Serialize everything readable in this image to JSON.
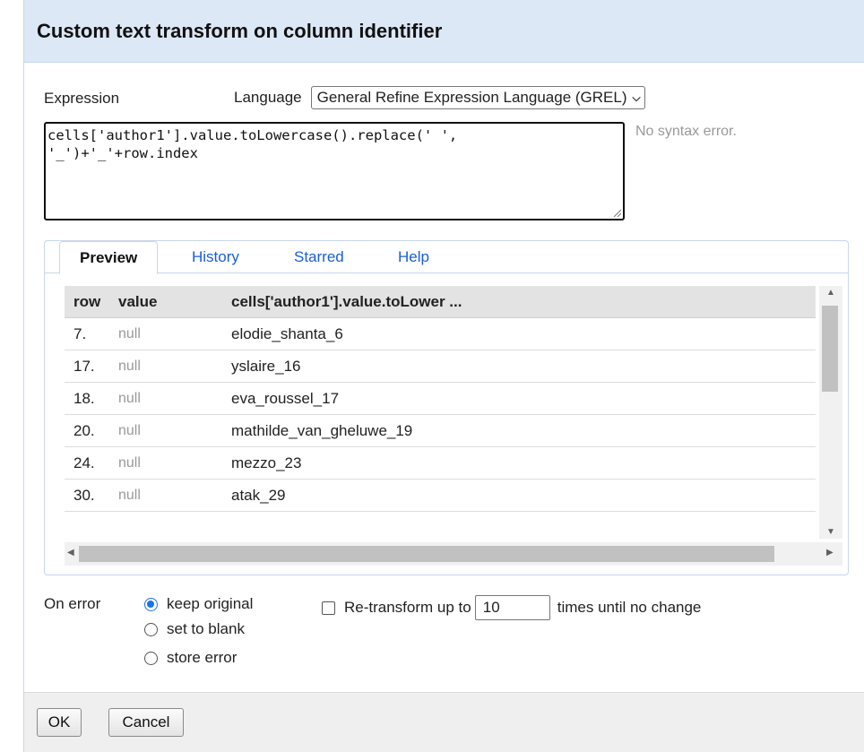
{
  "dialog": {
    "title": "Custom text transform on column identifier"
  },
  "expression": {
    "label": "Expression",
    "language_label": "Language",
    "language_selected": "General Refine Expression Language (GREL)",
    "code": "cells['author1'].value.toLowercase().replace(' ',\n'_')+'_'+row.index",
    "syntax_status": "No syntax error."
  },
  "tabs": [
    {
      "label": "Preview",
      "active": true
    },
    {
      "label": "History",
      "active": false
    },
    {
      "label": "Starred",
      "active": false
    },
    {
      "label": "Help",
      "active": false
    }
  ],
  "preview": {
    "headers": {
      "row": "row",
      "value": "value",
      "result": "cells['author1'].value.toLower ..."
    },
    "rows": [
      {
        "row": "7.",
        "value": "null",
        "result": "elodie_shanta_6"
      },
      {
        "row": "17.",
        "value": "null",
        "result": "yslaire_16"
      },
      {
        "row": "18.",
        "value": "null",
        "result": "eva_roussel_17"
      },
      {
        "row": "20.",
        "value": "null",
        "result": "mathilde_van_gheluwe_19"
      },
      {
        "row": "24.",
        "value": "null",
        "result": "mezzo_23"
      },
      {
        "row": "30.",
        "value": "null",
        "result": "atak_29"
      }
    ]
  },
  "on_error": {
    "label": "On error",
    "options": [
      {
        "label": "keep original",
        "selected": true
      },
      {
        "label": "set to blank",
        "selected": false
      },
      {
        "label": "store error",
        "selected": false
      }
    ]
  },
  "retransform": {
    "label": "Re-transform up to",
    "value": "10",
    "suffix": "times until no change",
    "checked": false
  },
  "buttons": {
    "ok": "OK",
    "cancel": "Cancel"
  },
  "colors": {
    "header_bg": "#dde8f6",
    "link": "#1a5fd8",
    "radio_accent": "#1a73e8"
  }
}
